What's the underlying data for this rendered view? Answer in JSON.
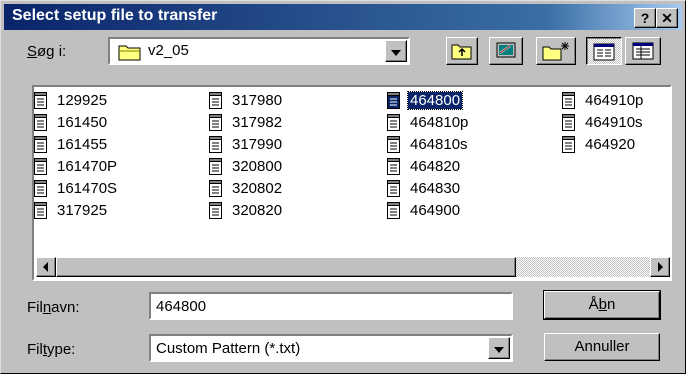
{
  "dialog": {
    "title": "Select setup file to transfer",
    "help_label": "?",
    "close_label": "✕"
  },
  "lookin": {
    "label_u": "S",
    "label_rest": "øg i:",
    "value": "v2_05"
  },
  "files": [
    {
      "name": "129925",
      "selected": false
    },
    {
      "name": "161450",
      "selected": false
    },
    {
      "name": "161455",
      "selected": false
    },
    {
      "name": "161470P",
      "selected": false
    },
    {
      "name": "161470S",
      "selected": false
    },
    {
      "name": "317925",
      "selected": false
    },
    {
      "name": "317980",
      "selected": false
    },
    {
      "name": "317982",
      "selected": false
    },
    {
      "name": "317990",
      "selected": false
    },
    {
      "name": "320800",
      "selected": false
    },
    {
      "name": "320802",
      "selected": false
    },
    {
      "name": "320820",
      "selected": false
    },
    {
      "name": "464800",
      "selected": true
    },
    {
      "name": "464810p",
      "selected": false
    },
    {
      "name": "464810s",
      "selected": false
    },
    {
      "name": "464820",
      "selected": false
    },
    {
      "name": "464830",
      "selected": false
    },
    {
      "name": "464900",
      "selected": false
    },
    {
      "name": "464910p",
      "selected": false
    },
    {
      "name": "464910s",
      "selected": false
    },
    {
      "name": "464920",
      "selected": false
    }
  ],
  "filename": {
    "label_a": "Fil",
    "label_u": "n",
    "label_b": "avn:",
    "value": "464800"
  },
  "filetype": {
    "label_a": "Fil",
    "label_u": "t",
    "label_b": "ype:",
    "value": "Custom Pattern (*.txt)"
  },
  "buttons": {
    "open_a": "Å",
    "open_u": "b",
    "open_b": "n",
    "cancel": "Annuller"
  },
  "colors": {
    "title_bar": "#0a246a",
    "selection": "#0a246a",
    "face": "#c0c0c0"
  }
}
